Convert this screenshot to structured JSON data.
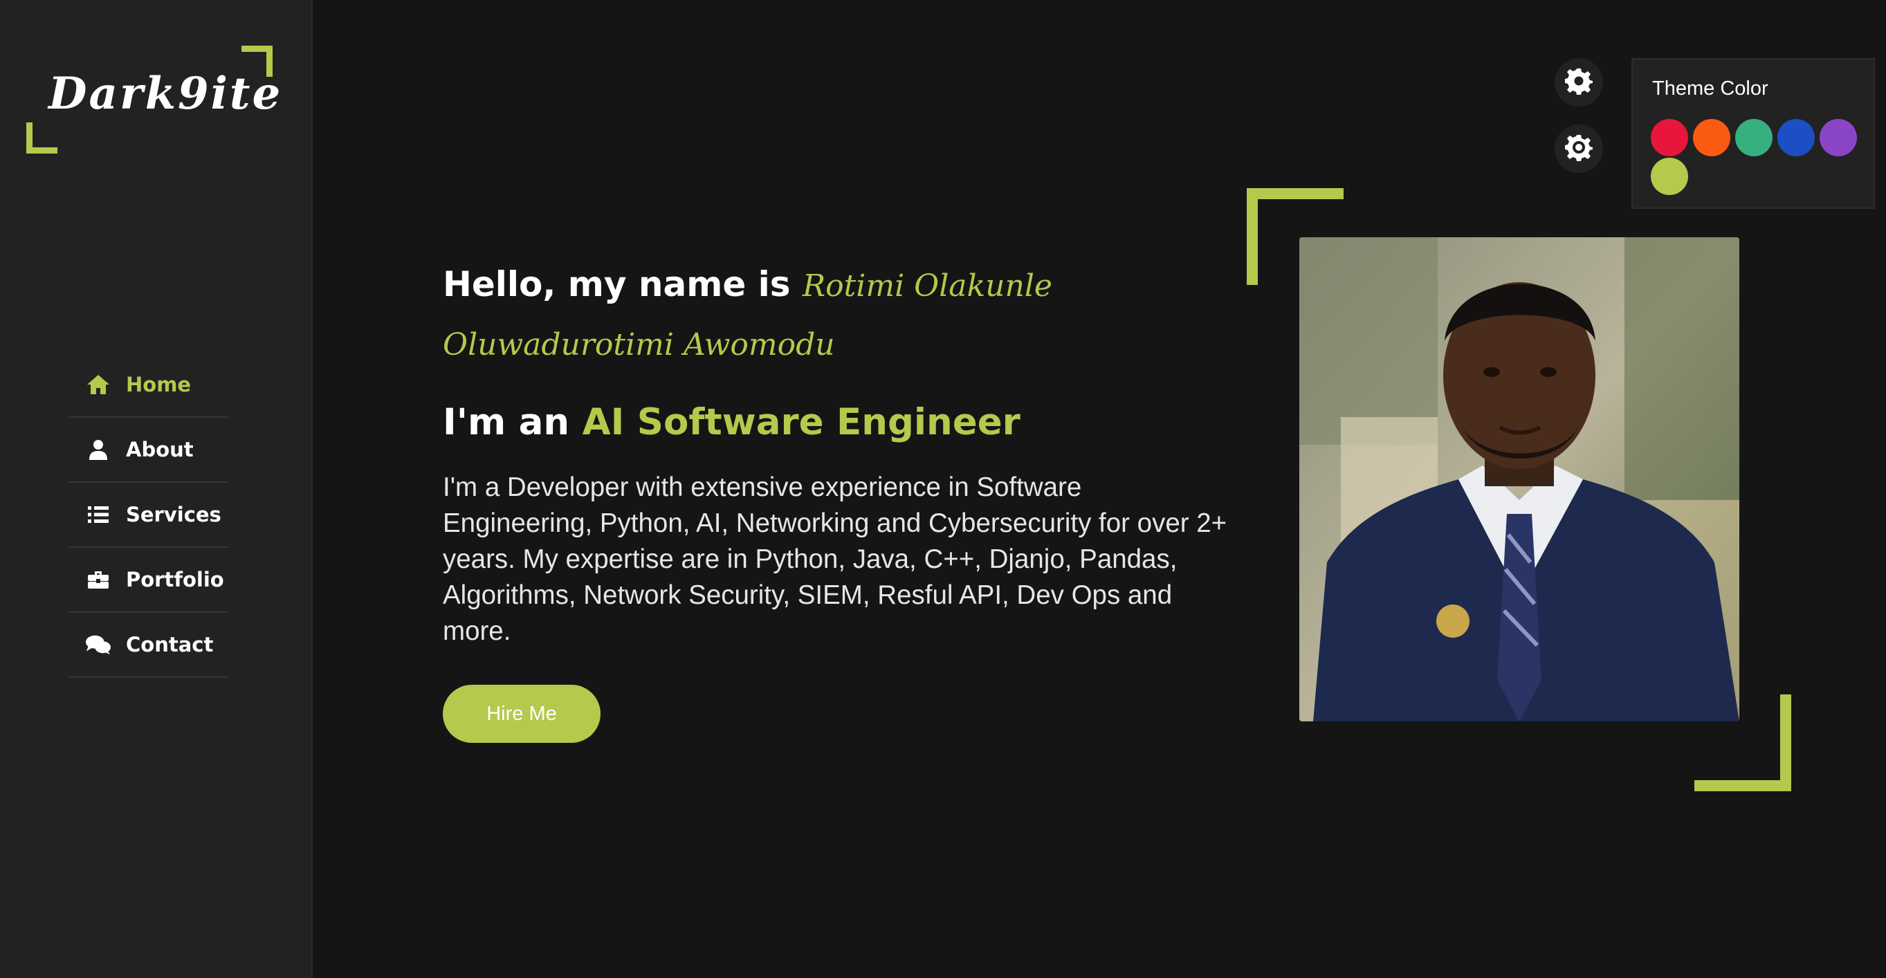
{
  "brand": {
    "logo_text": "Dark9ite"
  },
  "nav": {
    "items": [
      {
        "label": "Home",
        "icon": "home-icon",
        "active": true
      },
      {
        "label": "About",
        "icon": "user-icon"
      },
      {
        "label": "Services",
        "icon": "list-icon"
      },
      {
        "label": "Portfolio",
        "icon": "briefcase-icon"
      },
      {
        "label": "Contact",
        "icon": "chat-icon"
      }
    ]
  },
  "controls": {
    "settings_icon": "gear-icon",
    "day_night_icon": "sun-gear-icon"
  },
  "theme": {
    "title": "Theme Color",
    "colors": [
      "#e8163a",
      "#fb5a12",
      "#37b07f",
      "#1c4ec4",
      "#8a45c6",
      "#b5c94c"
    ],
    "accent": "#b5c94c"
  },
  "hero": {
    "hello_prefix": "Hello, my name is",
    "name": "Rotimi Olakunle Oluwadurotimi Awomodu",
    "role_prefix": "I'm an",
    "role": "AI Software Engineer",
    "bio": "I'm a Developer with extensive experience in Software Engineering, Python, AI, Networking and Cybersecurity for over 2+ years. My expertise are in Python, Java, C++, Djanjo, Pandas, Algorithms, Network Security, SIEM, Resful API, Dev Ops and more.",
    "hire_label": "Hire Me"
  }
}
